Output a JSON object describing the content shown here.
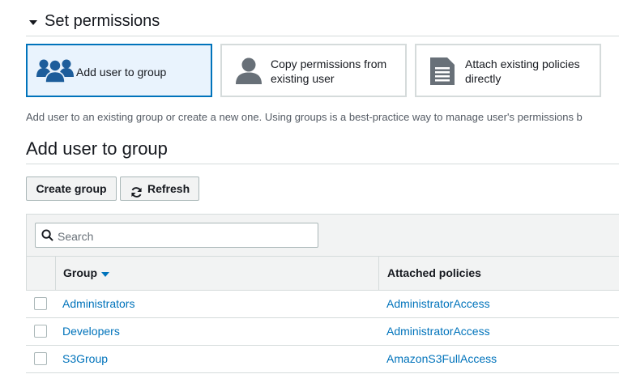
{
  "section": {
    "title": "Set permissions"
  },
  "options": [
    {
      "label": "Add user to group",
      "icon": "group-icon",
      "selected": true
    },
    {
      "label": "Copy permissions from existing user",
      "icon": "user-icon",
      "selected": false
    },
    {
      "label": "Attach existing policies directly",
      "icon": "document-icon",
      "selected": false
    }
  ],
  "description": "Add user to an existing group or create a new one. Using groups is a best-practice way to manage user's permissions b",
  "group_section": {
    "title": "Add user to group"
  },
  "buttons": {
    "create_group": "Create group",
    "refresh": "Refresh"
  },
  "search": {
    "placeholder": "Search",
    "value": ""
  },
  "table": {
    "columns": [
      {
        "label": "Group",
        "sorted": "descending"
      },
      {
        "label": "Attached policies"
      }
    ],
    "rows": [
      {
        "group": "Administrators",
        "policy": "AdministratorAccess",
        "checked": false
      },
      {
        "group": "Developers",
        "policy": "AdministratorAccess",
        "checked": false
      },
      {
        "group": "S3Group",
        "policy": "AmazonS3FullAccess",
        "checked": false
      }
    ]
  },
  "colors": {
    "accent": "#0073bb",
    "selected_bg": "#e9f3fd",
    "icon_blue": "#1d5d9b",
    "icon_gray": "#687078"
  }
}
